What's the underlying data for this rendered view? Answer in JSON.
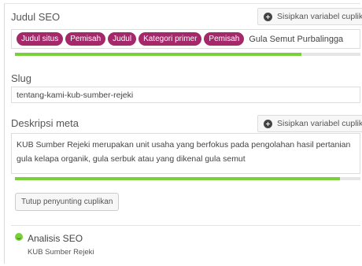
{
  "seo_title": {
    "label": "Judul SEO",
    "insert_button": "Sisipkan variabel cuplikan",
    "pills": [
      "Judul situs",
      "Pemisah",
      "Judul",
      "Kategori primer",
      "Pemisah"
    ],
    "text": "Gula Semut Purbalingga",
    "progress": 0.83,
    "progress_color": "#7ad03a"
  },
  "slug": {
    "label": "Slug",
    "value": "tentang-kami-kub-sumber-rejeki"
  },
  "meta_description": {
    "label": "Deskripsi meta",
    "insert_button": "Sisipkan variabel cuplikan",
    "value": "KUB Sumber Rejeki merupakan unit usaha yang berfokus pada pengolahan hasil pertanian gula kelapa organik, gula serbuk atau yang dikenal gula semut",
    "progress": 0.94,
    "progress_color": "#7ad03a"
  },
  "close_button": "Tutup penyunting cuplikan",
  "analysis": {
    "title": "Analisis SEO",
    "subtitle": "KUB Sumber Rejeki",
    "status_color": "#7ad03a",
    "status_icon": "smiley-icon"
  },
  "pill_color": "#a4286a"
}
